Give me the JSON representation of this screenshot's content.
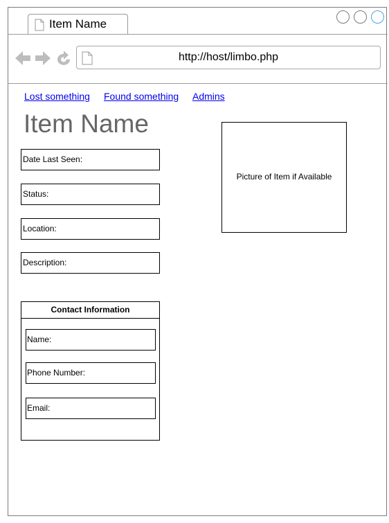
{
  "browser": {
    "tab_title": "Item Name",
    "url": "http://host/limbo.php",
    "icons": {
      "back": "back-arrow-icon",
      "forward": "forward-arrow-icon",
      "reload": "reload-icon",
      "page": "document-icon"
    },
    "window_buttons": [
      "circle",
      "circle",
      "circle-blue"
    ]
  },
  "nav": {
    "links": [
      "Lost something",
      "Found something",
      "Admins"
    ]
  },
  "item": {
    "title": "Item Name",
    "fields": {
      "date_last_seen": "Date Last Seen:",
      "status": "Status:",
      "location": "Location:",
      "description": "Description:"
    },
    "picture_label": "Picture of Item if Available"
  },
  "contact": {
    "header": "Contact Information",
    "name": "Name:",
    "phone": "Phone Number:",
    "email": "Email:"
  },
  "colors": {
    "link": "#0000ee",
    "title": "#666666",
    "accent": "#4aa3df",
    "icon_gray": "#bdbdbd"
  }
}
